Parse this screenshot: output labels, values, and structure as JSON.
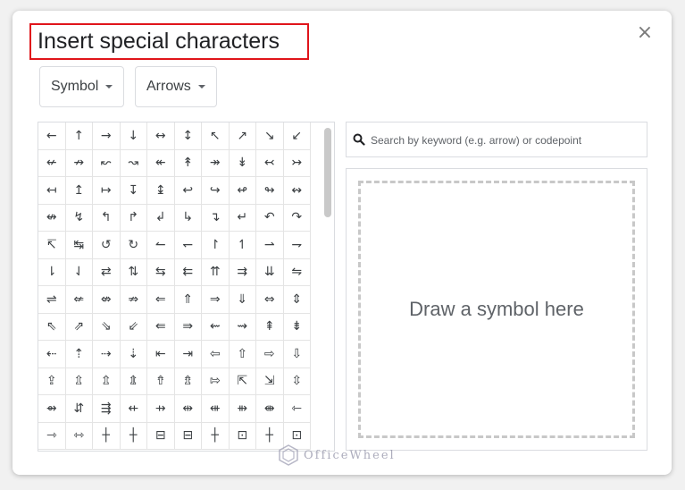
{
  "dialog": {
    "title": "Insert special characters",
    "close_glyph": "×",
    "category_dropdown": "Symbol",
    "subcategory_dropdown": "Arrows",
    "search_placeholder": "Search by keyword (e.g. arrow) or codepoint",
    "draw_label": "Draw a symbol here",
    "highlight_color": "#e0151b"
  },
  "symbols": [
    [
      "←",
      "↑",
      "→",
      "↓",
      "↔",
      "↕",
      "↖",
      "↗",
      "↘",
      "↙"
    ],
    [
      "↚",
      "↛",
      "↜",
      "↝",
      "↞",
      "↟",
      "↠",
      "↡",
      "↢",
      "↣"
    ],
    [
      "↤",
      "↥",
      "↦",
      "↧",
      "↨",
      "↩",
      "↪",
      "↫",
      "↬",
      "↭"
    ],
    [
      "↮",
      "↯",
      "↰",
      "↱",
      "↲",
      "↳",
      "↴",
      "↵",
      "↶",
      "↷"
    ],
    [
      "↸",
      "↹",
      "↺",
      "↻",
      "↼",
      "↽",
      "↾",
      "↿",
      "⇀",
      "⇁"
    ],
    [
      "⇂",
      "⇃",
      "⇄",
      "⇅",
      "⇆",
      "⇇",
      "⇈",
      "⇉",
      "⇊",
      "⇋"
    ],
    [
      "⇌",
      "⇍",
      "⇎",
      "⇏",
      "⇐",
      "⇑",
      "⇒",
      "⇓",
      "⇔",
      "⇕"
    ],
    [
      "⇖",
      "⇗",
      "⇘",
      "⇙",
      "⇚",
      "⇛",
      "⇜",
      "⇝",
      "⇞",
      "⇟"
    ],
    [
      "⇠",
      "⇡",
      "⇢",
      "⇣",
      "⇤",
      "⇥",
      "⇦",
      "⇧",
      "⇨",
      "⇩"
    ],
    [
      "⇪",
      "⇫",
      "⇬",
      "⇭",
      "⇮",
      "⇯",
      "⇰",
      "⇱",
      "⇲",
      "⇳"
    ],
    [
      "⇴",
      "⇵",
      "⇶",
      "⇷",
      "⇸",
      "⇹",
      "⇺",
      "⇻",
      "⇼",
      "⇽"
    ],
    [
      "⇾",
      "⇿",
      "┼",
      "┼",
      "⊟",
      "⊟",
      "┼",
      "⊡",
      "┼",
      "⊡"
    ]
  ],
  "watermark": "OfficeWheel"
}
